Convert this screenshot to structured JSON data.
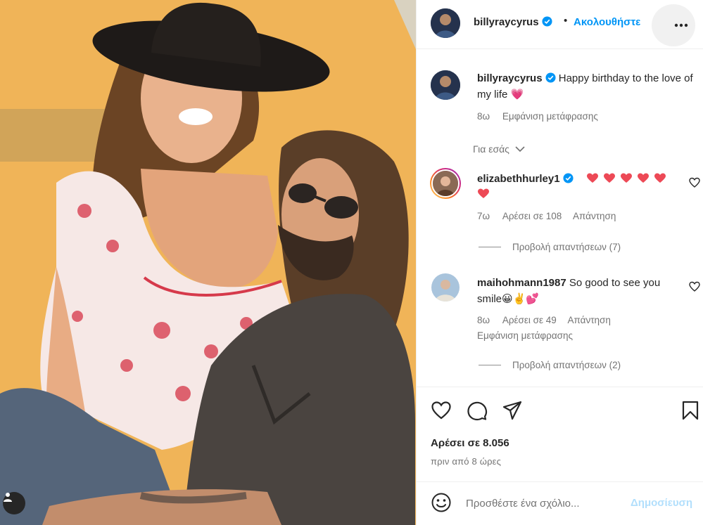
{
  "post": {
    "author": "billyraycyrus",
    "follow_label": "Ακολουθήστε",
    "separator": "•",
    "caption_text": "Happy birthday to the love of my life",
    "caption_emoji": "💗",
    "caption_age": "8ω",
    "caption_translate": "Εμφάνιση μετάφρασης",
    "for_you_label": "Για εσάς"
  },
  "comments": [
    {
      "username": "elizabethhurley1",
      "verified": true,
      "text": "",
      "hearts": 6,
      "age": "7ω",
      "likes": "Αρέσει σε 108",
      "reply": "Απάντηση",
      "view_replies": "Προβολή απαντήσεων (7)"
    },
    {
      "username": "maihohmann1987",
      "verified": false,
      "text": "So good to see you smile😀✌️💕",
      "age": "8ω",
      "likes": "Αρέσει σε 49",
      "reply": "Απάντηση",
      "translate": "Εμφάνιση μετάφρασης",
      "view_replies": "Προβολή απαντήσεων (2)"
    }
  ],
  "footer": {
    "likes_label": "Αρέσει σε 8.056",
    "time_label": "πριν από 8 ώρες",
    "comment_placeholder": "Προσθέστε ένα σχόλιο...",
    "post_label": "Δημοσίευση"
  },
  "colors": {
    "accent": "#0095f6",
    "verified": "#0095f6",
    "heart": "#ed4956",
    "muted": "#737373"
  },
  "icons": [
    "user-tag-icon",
    "verified-badge-icon",
    "more-options-icon",
    "chevron-down-icon",
    "heart-outline-icon",
    "comment-icon",
    "share-icon",
    "bookmark-icon",
    "emoji-icon"
  ]
}
